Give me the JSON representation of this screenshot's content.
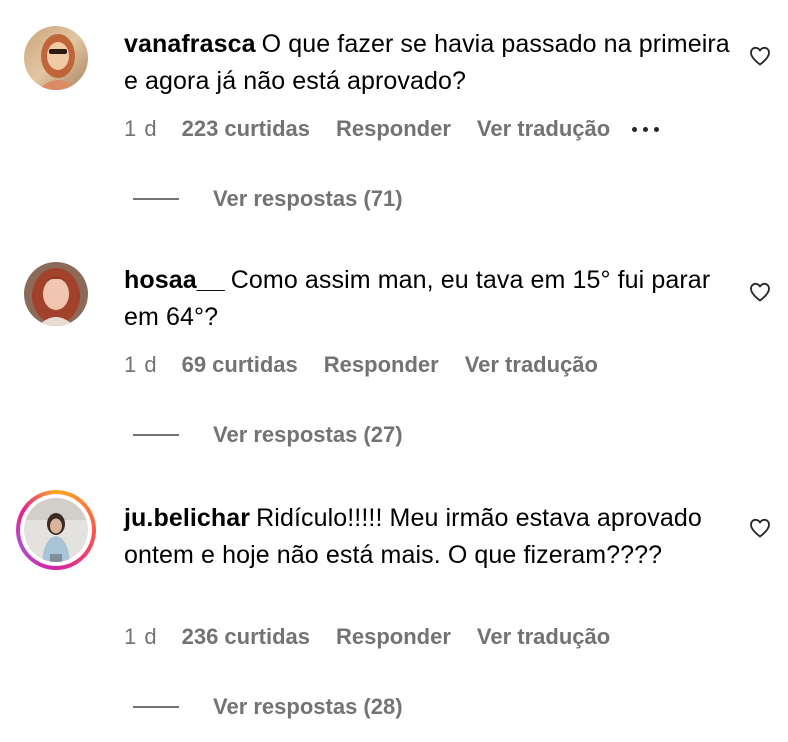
{
  "comments": [
    {
      "username": "vanafrasca",
      "text": "O que fazer se havia passado na primeira e agora já não está aprovado?",
      "time": "1 d",
      "likes": "223 curtidas",
      "reply_label": "Responder",
      "translate_label": "Ver tradução",
      "view_replies": "Ver respostas (71)",
      "has_more_menu": true,
      "story_ring": false
    },
    {
      "username": "hosaa__",
      "text": "Como assim man, eu tava em 15° fui parar em 64°?",
      "time": "1 d",
      "likes": "69 curtidas",
      "reply_label": "Responder",
      "translate_label": "Ver tradução",
      "view_replies": "Ver respostas (27)",
      "has_more_menu": false,
      "story_ring": false
    },
    {
      "username": "ju.belichar",
      "text": "Ridículo!!!!! Meu irmão estava aprovado ontem e hoje não está mais. O que fizeram????",
      "time": "1 d",
      "likes": "236 curtidas",
      "reply_label": "Responder",
      "translate_label": "Ver tradução",
      "view_replies": "Ver respostas (28)",
      "has_more_menu": false,
      "story_ring": true
    }
  ],
  "icons": {
    "heart": "heart-outline-icon",
    "more": "more-horizontal-icon"
  },
  "colors": {
    "secondary_text": "#737373",
    "primary_text": "#000000",
    "story_ring_gradient": [
      "#f9a825",
      "#fd5949",
      "#d6249f",
      "#b14ed1"
    ]
  }
}
